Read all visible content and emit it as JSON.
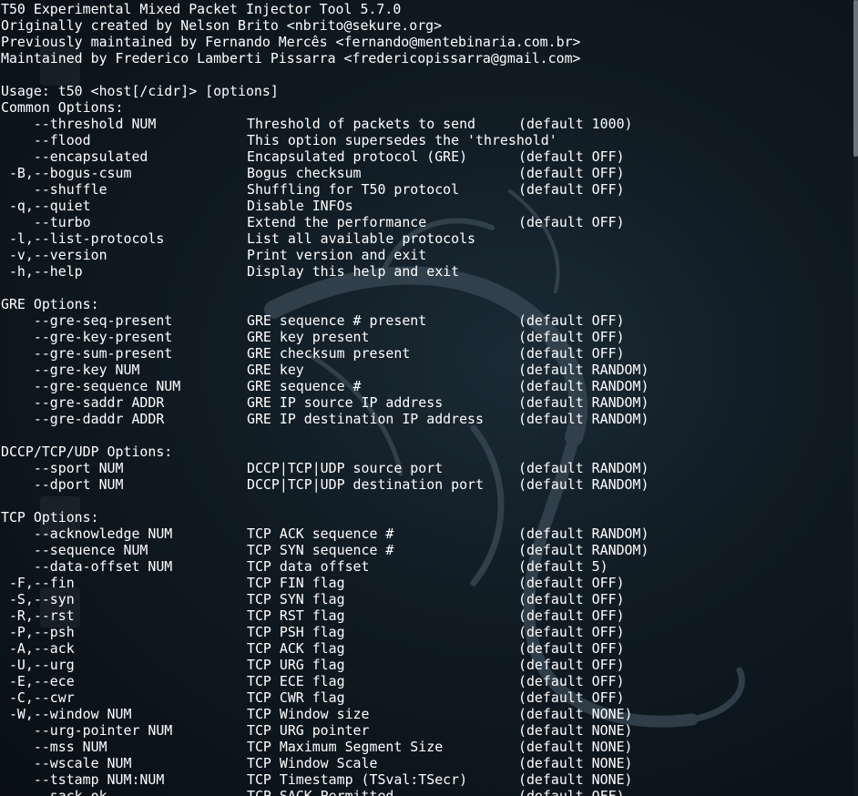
{
  "header": [
    "T50 Experimental Mixed Packet Injector Tool 5.7.0",
    "Originally created by Nelson Brito <nbrito@sekure.org>",
    "Previously maintained by Fernando Mercês <fernando@mentebinaria.com.br>",
    "Maintained by Frederico Lamberti Pissarra <fredericopissarra@gmail.com>",
    "",
    "Usage: t50 <host[/cidr]> [options]"
  ],
  "sections": [
    {
      "heading": "Common Options:",
      "options": [
        {
          "flag": "    --threshold NUM",
          "desc": "Threshold of packets to send",
          "default": "(default 1000)"
        },
        {
          "flag": "    --flood",
          "desc": "This option supersedes the 'threshold'",
          "default": ""
        },
        {
          "flag": "    --encapsulated",
          "desc": "Encapsulated protocol (GRE)",
          "default": "(default OFF)"
        },
        {
          "flag": " -B,--bogus-csum",
          "desc": "Bogus checksum",
          "default": "(default OFF)"
        },
        {
          "flag": "    --shuffle",
          "desc": "Shuffling for T50 protocol",
          "default": "(default OFF)"
        },
        {
          "flag": " -q,--quiet",
          "desc": "Disable INFOs",
          "default": ""
        },
        {
          "flag": "    --turbo",
          "desc": "Extend the performance",
          "default": "(default OFF)"
        },
        {
          "flag": " -l,--list-protocols",
          "desc": "List all available protocols",
          "default": ""
        },
        {
          "flag": " -v,--version",
          "desc": "Print version and exit",
          "default": ""
        },
        {
          "flag": " -h,--help",
          "desc": "Display this help and exit",
          "default": ""
        }
      ]
    },
    {
      "heading": "GRE Options:",
      "options": [
        {
          "flag": "    --gre-seq-present",
          "desc": "GRE sequence # present",
          "default": "(default OFF)"
        },
        {
          "flag": "    --gre-key-present",
          "desc": "GRE key present",
          "default": "(default OFF)"
        },
        {
          "flag": "    --gre-sum-present",
          "desc": "GRE checksum present",
          "default": "(default OFF)"
        },
        {
          "flag": "    --gre-key NUM",
          "desc": "GRE key",
          "default": "(default RANDOM)"
        },
        {
          "flag": "    --gre-sequence NUM",
          "desc": "GRE sequence #",
          "default": "(default RANDOM)"
        },
        {
          "flag": "    --gre-saddr ADDR",
          "desc": "GRE IP source IP address",
          "default": "(default RANDOM)"
        },
        {
          "flag": "    --gre-daddr ADDR",
          "desc": "GRE IP destination IP address",
          "default": "(default RANDOM)"
        }
      ]
    },
    {
      "heading": "DCCP/TCP/UDP Options:",
      "options": [
        {
          "flag": "    --sport NUM",
          "desc": "DCCP|TCP|UDP source port",
          "default": "(default RANDOM)"
        },
        {
          "flag": "    --dport NUM",
          "desc": "DCCP|TCP|UDP destination port",
          "default": "(default RANDOM)"
        }
      ]
    },
    {
      "heading": "TCP Options:",
      "options": [
        {
          "flag": "    --acknowledge NUM",
          "desc": "TCP ACK sequence #",
          "default": "(default RANDOM)"
        },
        {
          "flag": "    --sequence NUM",
          "desc": "TCP SYN sequence #",
          "default": "(default RANDOM)"
        },
        {
          "flag": "    --data-offset NUM",
          "desc": "TCP data offset",
          "default": "(default 5)"
        },
        {
          "flag": " -F,--fin",
          "desc": "TCP FIN flag",
          "default": "(default OFF)"
        },
        {
          "flag": " -S,--syn",
          "desc": "TCP SYN flag",
          "default": "(default OFF)"
        },
        {
          "flag": " -R,--rst",
          "desc": "TCP RST flag",
          "default": "(default OFF)"
        },
        {
          "flag": " -P,--psh",
          "desc": "TCP PSH flag",
          "default": "(default OFF)"
        },
        {
          "flag": " -A,--ack",
          "desc": "TCP ACK flag",
          "default": "(default OFF)"
        },
        {
          "flag": " -U,--urg",
          "desc": "TCP URG flag",
          "default": "(default OFF)"
        },
        {
          "flag": " -E,--ece",
          "desc": "TCP ECE flag",
          "default": "(default OFF)"
        },
        {
          "flag": " -C,--cwr",
          "desc": "TCP CWR flag",
          "default": "(default OFF)"
        },
        {
          "flag": " -W,--window NUM",
          "desc": "TCP Window size",
          "default": "(default NONE)"
        },
        {
          "flag": "    --urg-pointer NUM",
          "desc": "TCP URG pointer",
          "default": "(default NONE)"
        },
        {
          "flag": "    --mss NUM",
          "desc": "TCP Maximum Segment Size",
          "default": "(default NONE)"
        },
        {
          "flag": "    --wscale NUM",
          "desc": "TCP Window Scale",
          "default": "(default NONE)"
        },
        {
          "flag": "    --tstamp NUM:NUM",
          "desc": "TCP Timestamp (TSval:TSecr)",
          "default": "(default NONE)"
        },
        {
          "flag": "    --sack-ok",
          "desc": "TCP SACK-Permitted",
          "default": "(default OFF)"
        }
      ]
    }
  ],
  "colors": {
    "text": "#ffffff",
    "background": "#0f1a22",
    "dragon": "#3a4a56",
    "scrollbar_thumb": "#6b7278"
  },
  "icons": [
    "kali-dragon-wallpaper"
  ]
}
